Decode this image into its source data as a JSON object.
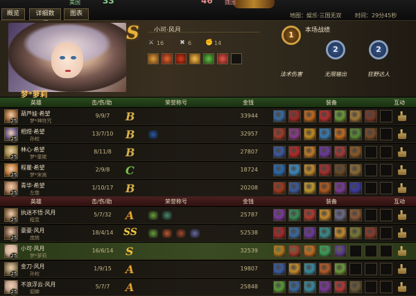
{
  "tabs": [
    "概览",
    "详细数据",
    "图表"
  ],
  "score": {
    "left_team": "美国",
    "left_score": "33",
    "right_score": "46",
    "right_team": "魏国"
  },
  "map_info": "地图：娱乐·三国无双",
  "time_info": "时间：29分45秒",
  "hero": {
    "rank": "S",
    "player": "小可·风月",
    "hero_name": "梦*萝莉",
    "kills": "16",
    "deaths": "6",
    "assists": "14"
  },
  "battle": {
    "title": "本场战绩",
    "medals": [
      {
        "level": "1",
        "label": "法术伤害"
      },
      {
        "level": "2",
        "label": "无限输出"
      },
      {
        "level": "2",
        "label": "狂野达人"
      }
    ]
  },
  "headers": {
    "hero": "英雄",
    "kda": "击/伤/助",
    "honor": "荣誉称号",
    "gold": "金钱",
    "equip": "装备",
    "interact": "互动"
  },
  "team1": [
    {
      "name": "葫芦娃·希望",
      "sub": "梦*神符咒",
      "level": "25",
      "kda": "9/9/7",
      "grade": "B",
      "gold": "33944",
      "avatar": "#a06a3a",
      "honors": [],
      "items": [
        "#3a6aa0",
        "#a02a2a",
        "#c06a20",
        "#b03030",
        "#6a9a3a",
        "#a07a3a",
        "#7a3a2a",
        "empty"
      ]
    },
    {
      "name": "相煜·希望",
      "sub": "孙权",
      "level": "25",
      "kda": "13/7/10",
      "grade": "B",
      "gold": "32957",
      "avatar": "#6a5a8a",
      "honors": [
        "#2a5aa0"
      ],
      "items": [
        "#a03a2a",
        "#8a3a8a",
        "#c08a20",
        "#3a7ab0",
        "#c06a20",
        "#5a8a3a",
        "#7a4a2a",
        "empty"
      ]
    },
    {
      "name": "林心·希望",
      "sub": "梦*童姥",
      "level": "25",
      "kda": "8/11/8",
      "grade": "B",
      "gold": "27807",
      "avatar": "#a08a4a",
      "honors": [],
      "items": [
        "#3a5aa0",
        "#b02a2a",
        "#c07a2a",
        "#6a3a9a",
        "#a03a3a",
        "#8a5a2a",
        "empty",
        "empty"
      ]
    },
    {
      "name": "程瞿·希望",
      "sub": "梦*宋嵩",
      "level": "25",
      "kda": "2/9/8",
      "grade": "C",
      "gold": "18724",
      "avatar": "#c07a3a",
      "honors": [],
      "items": [
        "#2a6ab0",
        "#3a8ac0",
        "#c08a30",
        "#a03030",
        "#6a4a2a",
        "#8a6a3a",
        "empty",
        "empty"
      ]
    },
    {
      "name": "青华·希望",
      "sub": "左慈",
      "level": "25",
      "kda": "1/10/17",
      "grade": "B",
      "gold": "20208",
      "avatar": "#b08060",
      "honors": [],
      "items": [
        "#a03a20",
        "#3a5aa0",
        "#c09a30",
        "#b05a20",
        "#7a3a9a",
        "#3a3aa0",
        "empty",
        "empty"
      ]
    }
  ],
  "team2": [
    {
      "name": "执迷不悟·风月",
      "sub": "程昱",
      "level": "25",
      "kda": "5/7/32",
      "grade": "A",
      "gold": "25787",
      "avatar": "#8a6a4a",
      "honors": [
        "#6aa03a",
        "#4a8a6a"
      ],
      "items": [
        "#7a3a9a",
        "#3a8a5a",
        "#b03a30",
        "#c08a30",
        "#6a6a8a",
        "#8a5a3a",
        "empty",
        "empty"
      ]
    },
    {
      "name": "豪豪·风月",
      "sub": "庞统",
      "level": "25",
      "kda": "18/4/14",
      "grade": "SS",
      "gold": "52538",
      "avatar": "#7a5a4a",
      "honors": [
        "#6aa03a",
        "#c05a30",
        "#a04a30",
        "#6a6aa0"
      ],
      "items": [
        "#a02a2a",
        "#3a6aa0",
        "#6a3a9a",
        "#3a8a8a",
        "#c08a30",
        "#7a7a3a",
        "#8a3a2a",
        "empty"
      ]
    },
    {
      "name": "小可·风月",
      "sub": "梦*萝莉",
      "level": "25",
      "kda": "16/6/14",
      "grade": "S",
      "gold": "32539",
      "avatar": "#d0b0a0",
      "honors": [],
      "items": [
        "#b07a20",
        "#a03a2a",
        "#c06a20",
        "#3a9a5a",
        "#5a3a8a",
        "empty",
        "empty",
        "empty"
      ],
      "me": true
    },
    {
      "name": "金刀·风月",
      "sub": "孙权",
      "level": "25",
      "kda": "1/9/15",
      "grade": "A",
      "gold": "19807",
      "avatar": "#8a7a5a",
      "honors": [],
      "items": [
        "#3a5aa0",
        "#c08a30",
        "#3a8aa0",
        "#b05a2a",
        "#6a9a3a",
        "empty",
        "empty",
        "empty"
      ]
    },
    {
      "name": "不浪浮云·风月",
      "sub": "貂蝉",
      "level": "25",
      "kda": "5/7/7",
      "grade": "A",
      "gold": "25848",
      "avatar": "#c0a090",
      "honors": [],
      "items": [
        "#5a9a3a",
        "#3a6aa0",
        "#3a8aa0",
        "#7a3a9a",
        "#b03a3a",
        "#6a5a3a",
        "empty",
        "empty"
      ]
    }
  ],
  "colors": {
    "grade_s": "#f0b83a",
    "grade_a": "#e0a030",
    "grade_b": "#d8b048",
    "grade_c": "#7ac04a",
    "grade_ss": "#f0c840"
  }
}
